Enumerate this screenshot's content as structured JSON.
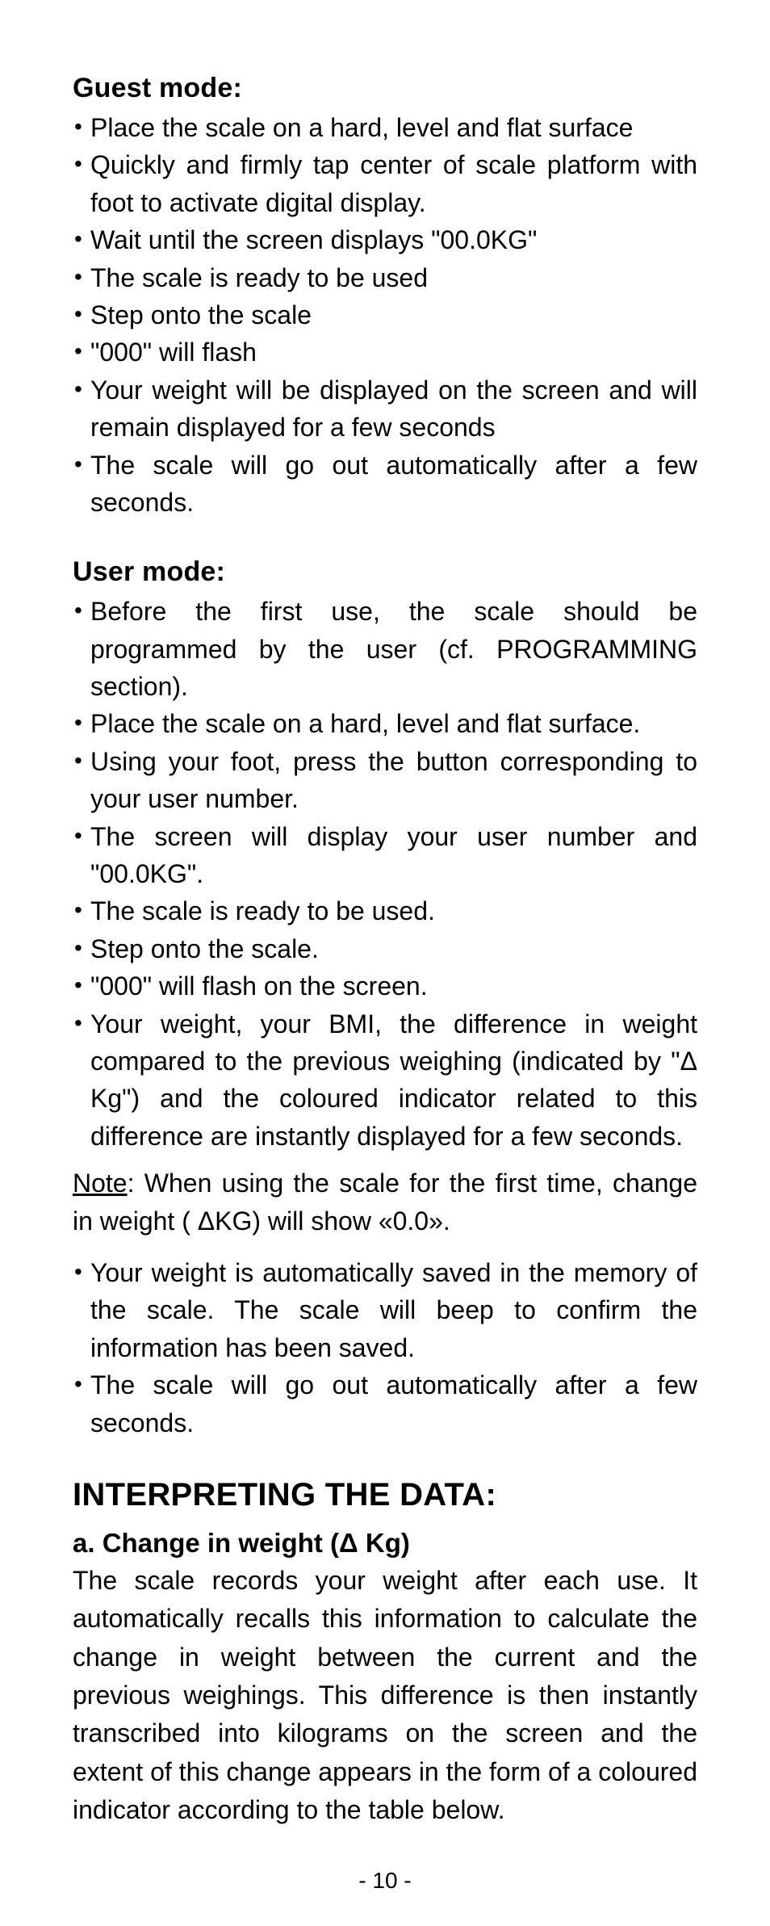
{
  "sections": {
    "guest": {
      "title": "Guest mode:",
      "items": [
        "Place the scale on a hard, level and flat surface",
        "Quickly and firmly tap center of scale platform with foot to activate digital display.",
        "Wait until the screen displays \"00.0KG\"",
        "The scale is ready to be used",
        "Step onto the scale",
        "\"000\" will flash",
        "Your weight will be displayed on the screen and will remain displayed for a few seconds",
        "The scale will go out automatically after a few seconds."
      ]
    },
    "user": {
      "title": "User mode:",
      "items_a": [
        "Before the first use, the scale should be programmed by the user (cf. PROGRAMMING section).",
        "Place the scale on a hard, level and flat surface.",
        "Using your foot, press the button corresponding to your user number.",
        "The screen will display your user number and \"00.0KG\".",
        "The scale is ready to be used.",
        "Step onto the scale.",
        "\"000\" will flash on the screen.",
        "Your weight, your BMI, the difference in weight compared to the previous weighing (indicated by \"Δ Kg\") and the coloured indicator related to this difference are instantly displayed for a few seconds."
      ],
      "note_label": "Note",
      "note_rest": ": When using the scale for the first time, change in weight ( ΔKG) will show «0.0».",
      "items_b": [
        "Your weight is automatically saved in the memory of the scale. The scale will beep to confirm the information has been saved.",
        "The scale will go out automatically after a few seconds."
      ]
    },
    "interpret": {
      "heading": "INTERPRETING THE DATA:",
      "sub_a_title": "a. Change in weight (Δ Kg)",
      "sub_a_body": "The scale records your weight after each use. It automatically recalls this information to calculate the change in weight between the current and the previous weighings. This difference is then instantly transcribed into kilograms on the screen and the extent of this change appears in the form of a coloured indicator according to the table below."
    }
  },
  "page_number": "- 10 -"
}
